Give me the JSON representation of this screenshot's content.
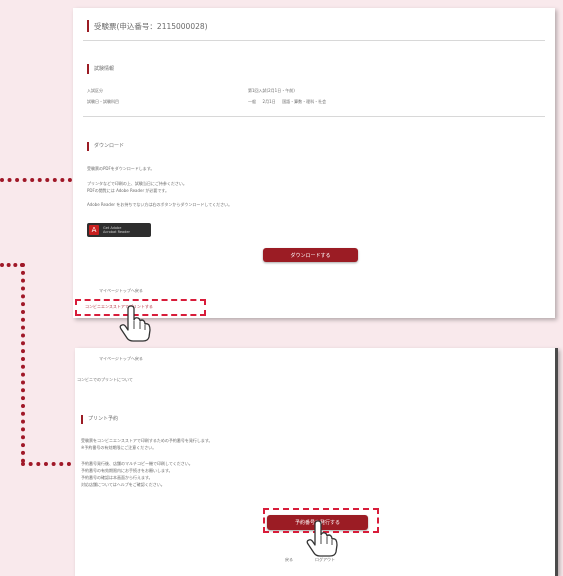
{
  "panel1": {
    "header_title": "受験票(申込番号：2115000028)",
    "info_section": {
      "title": "試験情報",
      "rows": [
        {
          "label": "入試区分",
          "value": "第1回入試(2月1日・午前)"
        },
        {
          "label": "試験日・試験科目",
          "value": "一般 　 2月1日 　 国語・算数・理科・社会"
        }
      ]
    },
    "download_section": {
      "title": "ダウンロード",
      "line1": "受験票のPDFをダウンロードします。",
      "line2": "プリンタなどで印刷の上、試験当日にご持参ください。",
      "line3": "PDFの閲覧には Adobe Reader が必要です。",
      "line4": "Adobe Reader をお持ちでない方は右のボタンからダウンロードしてください。",
      "adobe_label_1": "Get Adobe",
      "adobe_label_2": "Acrobat Reader",
      "download_button": "ダウンロードする",
      "back_link": "マイページトップへ戻る",
      "print_link": "コンビニエンスストアでプリントする"
    }
  },
  "panel2": {
    "back_link": "マイページトップへ戻る",
    "subtext": "コンビニでのプリントについて",
    "section_title": "プリント予約",
    "para1_line1": "受験票をコンビニエンスストアで印刷するための予約番号を発行します。",
    "para1_line2": "※予約番号の有効期限にご注意ください。",
    "para2_line1": "予約番号発行後、店舗のマルチコピー機で印刷してください。",
    "para2_line2": "予約番号の有効期限内にお手続きをお願いします。",
    "para2_line3": "予約番号の確認は本画面から行えます。",
    "para2_line4": "対応店舗についてはヘルプをご確認ください。",
    "reserve_button": "予約番号を発行する",
    "footer_back": "戻る",
    "footer_logout": "ログアウト"
  }
}
